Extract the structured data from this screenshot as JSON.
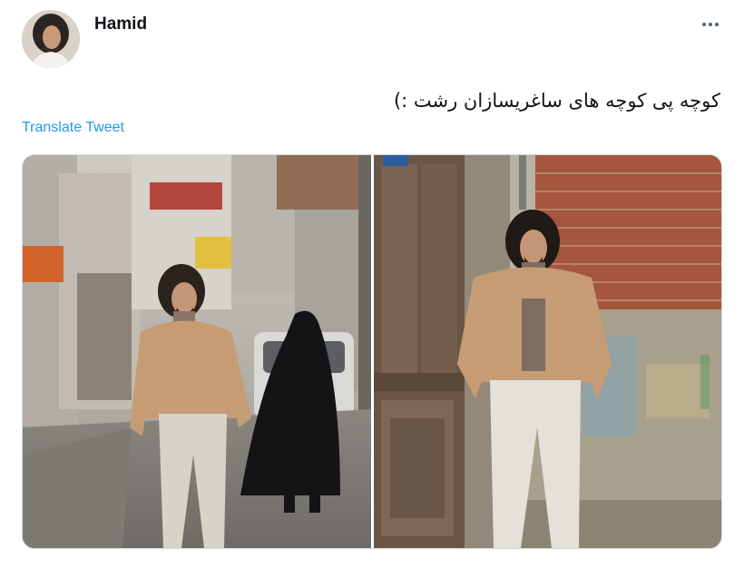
{
  "tweet": {
    "author_name": "Hamid",
    "text": "کوچه پی کوچه های ساغریسازان رشت :)",
    "translate_label": "Translate Tweet"
  },
  "icons": {
    "more": "more-horizontal-icon",
    "avatar": "avatar"
  },
  "media": {
    "count": 2
  },
  "colors": {
    "link": "#1d9bf0",
    "text": "#0f1419",
    "muted": "#536471"
  }
}
